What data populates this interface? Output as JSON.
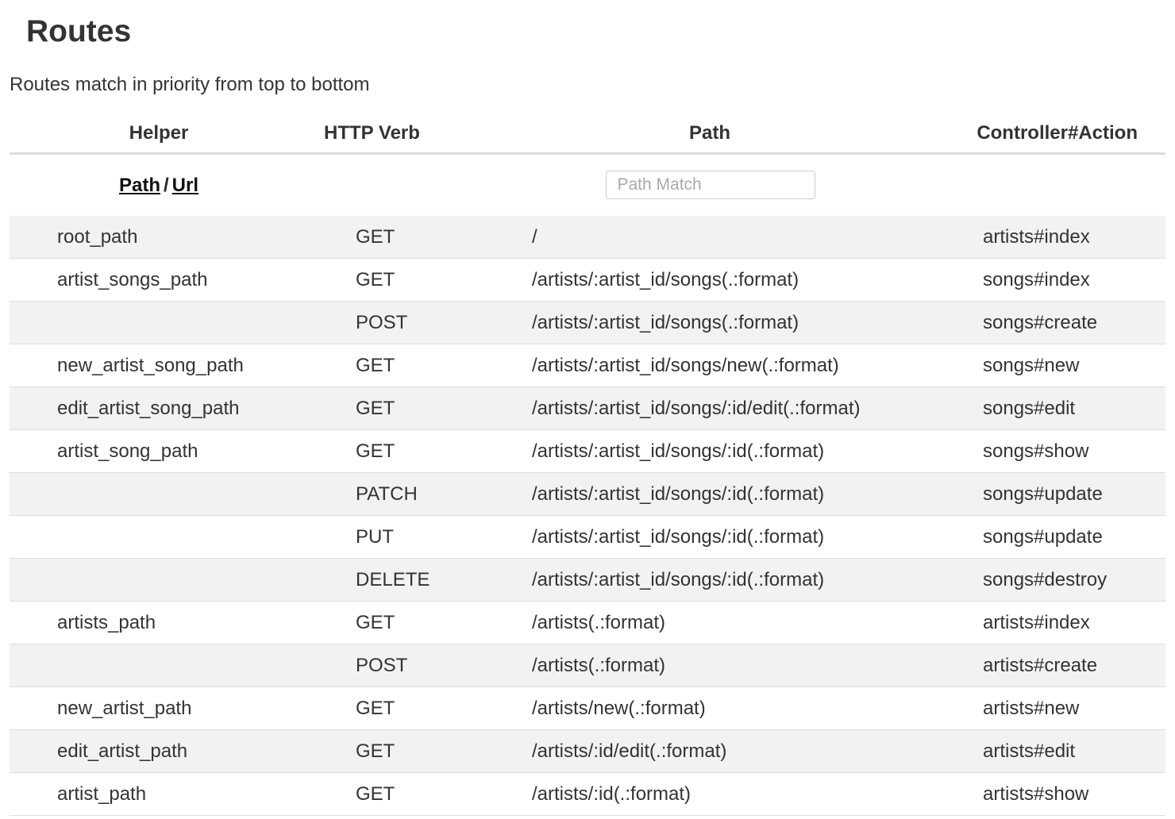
{
  "page": {
    "title": "Routes",
    "subtitle": "Routes match in priority from top to bottom"
  },
  "table": {
    "headers": {
      "helper": "Helper",
      "verb": "HTTP Verb",
      "path": "Path",
      "action": "Controller#Action"
    },
    "filter": {
      "path_link": "Path",
      "separator": "/",
      "url_link": "Url",
      "search_placeholder": "Path Match",
      "search_value": ""
    },
    "rows": [
      {
        "helper": "root_path",
        "verb": "GET",
        "path": "/",
        "action": "artists#index"
      },
      {
        "helper": "artist_songs_path",
        "verb": "GET",
        "path": "/artists/:artist_id/songs(.:format)",
        "action": "songs#index"
      },
      {
        "helper": "",
        "verb": "POST",
        "path": "/artists/:artist_id/songs(.:format)",
        "action": "songs#create"
      },
      {
        "helper": "new_artist_song_path",
        "verb": "GET",
        "path": "/artists/:artist_id/songs/new(.:format)",
        "action": "songs#new"
      },
      {
        "helper": "edit_artist_song_path",
        "verb": "GET",
        "path": "/artists/:artist_id/songs/:id/edit(.:format)",
        "action": "songs#edit"
      },
      {
        "helper": "artist_song_path",
        "verb": "GET",
        "path": "/artists/:artist_id/songs/:id(.:format)",
        "action": "songs#show"
      },
      {
        "helper": "",
        "verb": "PATCH",
        "path": "/artists/:artist_id/songs/:id(.:format)",
        "action": "songs#update"
      },
      {
        "helper": "",
        "verb": "PUT",
        "path": "/artists/:artist_id/songs/:id(.:format)",
        "action": "songs#update"
      },
      {
        "helper": "",
        "verb": "DELETE",
        "path": "/artists/:artist_id/songs/:id(.:format)",
        "action": "songs#destroy"
      },
      {
        "helper": "artists_path",
        "verb": "GET",
        "path": "/artists(.:format)",
        "action": "artists#index"
      },
      {
        "helper": "",
        "verb": "POST",
        "path": "/artists(.:format)",
        "action": "artists#create"
      },
      {
        "helper": "new_artist_path",
        "verb": "GET",
        "path": "/artists/new(.:format)",
        "action": "artists#new"
      },
      {
        "helper": "edit_artist_path",
        "verb": "GET",
        "path": "/artists/:id/edit(.:format)",
        "action": "artists#edit"
      },
      {
        "helper": "artist_path",
        "verb": "GET",
        "path": "/artists/:id(.:format)",
        "action": "artists#show"
      }
    ]
  },
  "colors": {
    "text": "#333333",
    "row_stripe": "#f2f2f2",
    "border": "#dddddd"
  }
}
